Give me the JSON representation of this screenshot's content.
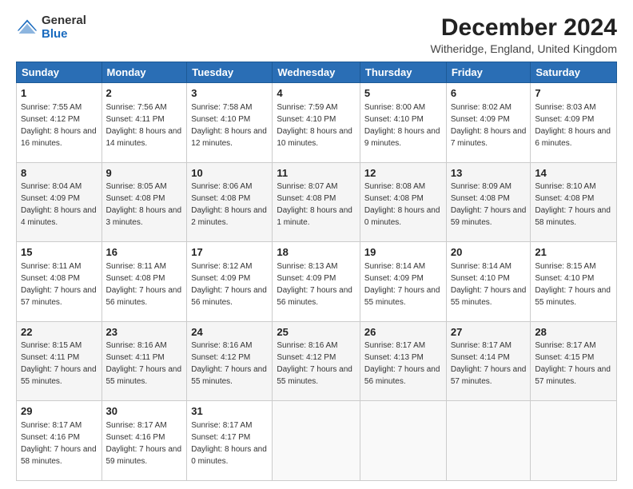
{
  "logo": {
    "general": "General",
    "blue": "Blue"
  },
  "title": "December 2024",
  "subtitle": "Witheridge, England, United Kingdom",
  "days_header": [
    "Sunday",
    "Monday",
    "Tuesday",
    "Wednesday",
    "Thursday",
    "Friday",
    "Saturday"
  ],
  "weeks": [
    [
      {
        "num": "1",
        "sunrise": "7:55 AM",
        "sunset": "4:12 PM",
        "daylight": "8 hours and 16 minutes."
      },
      {
        "num": "2",
        "sunrise": "7:56 AM",
        "sunset": "4:11 PM",
        "daylight": "8 hours and 14 minutes."
      },
      {
        "num": "3",
        "sunrise": "7:58 AM",
        "sunset": "4:10 PM",
        "daylight": "8 hours and 12 minutes."
      },
      {
        "num": "4",
        "sunrise": "7:59 AM",
        "sunset": "4:10 PM",
        "daylight": "8 hours and 10 minutes."
      },
      {
        "num": "5",
        "sunrise": "8:00 AM",
        "sunset": "4:10 PM",
        "daylight": "8 hours and 9 minutes."
      },
      {
        "num": "6",
        "sunrise": "8:02 AM",
        "sunset": "4:09 PM",
        "daylight": "8 hours and 7 minutes."
      },
      {
        "num": "7",
        "sunrise": "8:03 AM",
        "sunset": "4:09 PM",
        "daylight": "8 hours and 6 minutes."
      }
    ],
    [
      {
        "num": "8",
        "sunrise": "8:04 AM",
        "sunset": "4:09 PM",
        "daylight": "8 hours and 4 minutes."
      },
      {
        "num": "9",
        "sunrise": "8:05 AM",
        "sunset": "4:08 PM",
        "daylight": "8 hours and 3 minutes."
      },
      {
        "num": "10",
        "sunrise": "8:06 AM",
        "sunset": "4:08 PM",
        "daylight": "8 hours and 2 minutes."
      },
      {
        "num": "11",
        "sunrise": "8:07 AM",
        "sunset": "4:08 PM",
        "daylight": "8 hours and 1 minute."
      },
      {
        "num": "12",
        "sunrise": "8:08 AM",
        "sunset": "4:08 PM",
        "daylight": "8 hours and 0 minutes."
      },
      {
        "num": "13",
        "sunrise": "8:09 AM",
        "sunset": "4:08 PM",
        "daylight": "7 hours and 59 minutes."
      },
      {
        "num": "14",
        "sunrise": "8:10 AM",
        "sunset": "4:08 PM",
        "daylight": "7 hours and 58 minutes."
      }
    ],
    [
      {
        "num": "15",
        "sunrise": "8:11 AM",
        "sunset": "4:08 PM",
        "daylight": "7 hours and 57 minutes."
      },
      {
        "num": "16",
        "sunrise": "8:11 AM",
        "sunset": "4:08 PM",
        "daylight": "7 hours and 56 minutes."
      },
      {
        "num": "17",
        "sunrise": "8:12 AM",
        "sunset": "4:09 PM",
        "daylight": "7 hours and 56 minutes."
      },
      {
        "num": "18",
        "sunrise": "8:13 AM",
        "sunset": "4:09 PM",
        "daylight": "7 hours and 56 minutes."
      },
      {
        "num": "19",
        "sunrise": "8:14 AM",
        "sunset": "4:09 PM",
        "daylight": "7 hours and 55 minutes."
      },
      {
        "num": "20",
        "sunrise": "8:14 AM",
        "sunset": "4:10 PM",
        "daylight": "7 hours and 55 minutes."
      },
      {
        "num": "21",
        "sunrise": "8:15 AM",
        "sunset": "4:10 PM",
        "daylight": "7 hours and 55 minutes."
      }
    ],
    [
      {
        "num": "22",
        "sunrise": "8:15 AM",
        "sunset": "4:11 PM",
        "daylight": "7 hours and 55 minutes."
      },
      {
        "num": "23",
        "sunrise": "8:16 AM",
        "sunset": "4:11 PM",
        "daylight": "7 hours and 55 minutes."
      },
      {
        "num": "24",
        "sunrise": "8:16 AM",
        "sunset": "4:12 PM",
        "daylight": "7 hours and 55 minutes."
      },
      {
        "num": "25",
        "sunrise": "8:16 AM",
        "sunset": "4:12 PM",
        "daylight": "7 hours and 55 minutes."
      },
      {
        "num": "26",
        "sunrise": "8:17 AM",
        "sunset": "4:13 PM",
        "daylight": "7 hours and 56 minutes."
      },
      {
        "num": "27",
        "sunrise": "8:17 AM",
        "sunset": "4:14 PM",
        "daylight": "7 hours and 57 minutes."
      },
      {
        "num": "28",
        "sunrise": "8:17 AM",
        "sunset": "4:15 PM",
        "daylight": "7 hours and 57 minutes."
      }
    ],
    [
      {
        "num": "29",
        "sunrise": "8:17 AM",
        "sunset": "4:16 PM",
        "daylight": "7 hours and 58 minutes."
      },
      {
        "num": "30",
        "sunrise": "8:17 AM",
        "sunset": "4:16 PM",
        "daylight": "7 hours and 59 minutes."
      },
      {
        "num": "31",
        "sunrise": "8:17 AM",
        "sunset": "4:17 PM",
        "daylight": "8 hours and 0 minutes."
      },
      null,
      null,
      null,
      null
    ]
  ]
}
